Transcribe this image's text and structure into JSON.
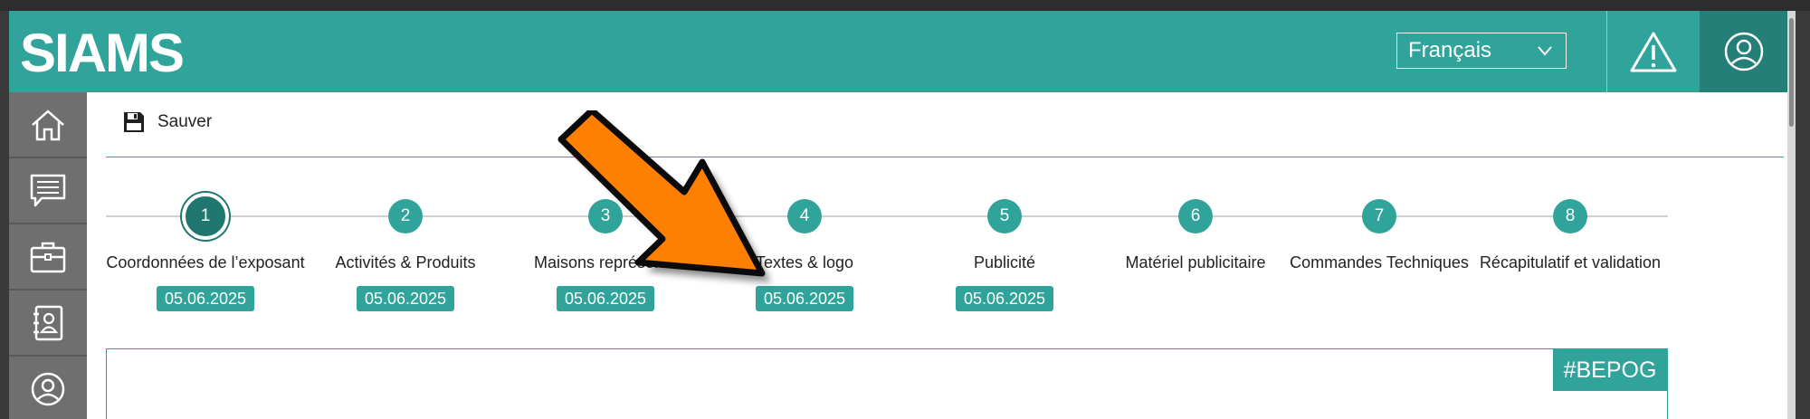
{
  "header": {
    "logo_text": "SIAMS",
    "language": "Français",
    "alert_icon": "warning-triangle-icon",
    "user_icon": "user-circle-icon"
  },
  "sidebar": {
    "items": [
      {
        "icon": "home-icon"
      },
      {
        "icon": "message-icon"
      },
      {
        "icon": "briefcase-icon"
      },
      {
        "icon": "contacts-book-icon"
      },
      {
        "icon": "user-circle-icon"
      }
    ]
  },
  "toolbar": {
    "save_label": "Sauver",
    "save_icon": "floppy-disk-icon"
  },
  "steps": [
    {
      "number": "1",
      "label": "Coordonnées de l’exposant",
      "date": "05.06.2025",
      "active": true
    },
    {
      "number": "2",
      "label": "Activités & Produits",
      "date": "05.06.2025"
    },
    {
      "number": "3",
      "label": "Maisons représenté",
      "date": "05.06.2025"
    },
    {
      "number": "4",
      "label": "Textes & logo",
      "date": "05.06.2025"
    },
    {
      "number": "5",
      "label": "Publicité",
      "date": "05.06.2025"
    },
    {
      "number": "6",
      "label": "Matériel publicitaire"
    },
    {
      "number": "7",
      "label": "Commandes Techniques"
    },
    {
      "number": "8",
      "label": "Récapitulatif et validation"
    }
  ],
  "panel": {
    "tag": "#BEPOG"
  },
  "colors": {
    "accent": "#30a39a",
    "accent_dark": "#1f7770",
    "sidebar": "#6f6f6f",
    "arrow": "#ff8000"
  }
}
